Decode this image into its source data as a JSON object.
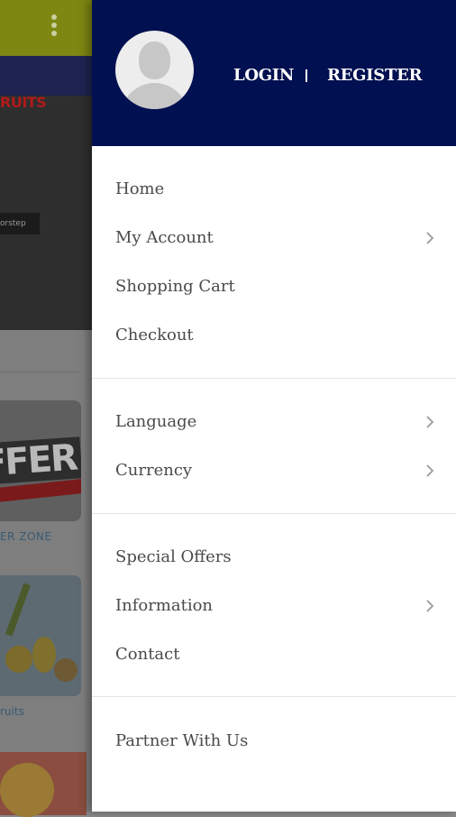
{
  "background": {
    "banner_text": "RUITS",
    "banner_sub": "orstep",
    "offer_text": "FFER",
    "card1_label": "ER ZONE",
    "card2_label": "ruits"
  },
  "drawer": {
    "header": {
      "login_label": "LOGIN",
      "register_label": "REGISTER",
      "avatar_icon": "user-avatar-icon"
    },
    "sections": [
      {
        "items": [
          {
            "label": "Home",
            "has_submenu": false
          },
          {
            "label": "My Account",
            "has_submenu": true
          },
          {
            "label": "Shopping Cart",
            "has_submenu": false
          },
          {
            "label": "Checkout",
            "has_submenu": false
          }
        ]
      },
      {
        "items": [
          {
            "label": "Language",
            "has_submenu": true
          },
          {
            "label": "Currency",
            "has_submenu": true
          }
        ]
      },
      {
        "items": [
          {
            "label": "Special Offers",
            "has_submenu": false
          },
          {
            "label": "Information",
            "has_submenu": true
          },
          {
            "label": "Contact",
            "has_submenu": false
          }
        ]
      },
      {
        "items": [
          {
            "label": "Partner With Us",
            "has_submenu": false
          }
        ]
      }
    ]
  },
  "colors": {
    "drawer_header": "#001050",
    "topbar": "#7d8712",
    "menu_text": "#4a4a4a"
  }
}
